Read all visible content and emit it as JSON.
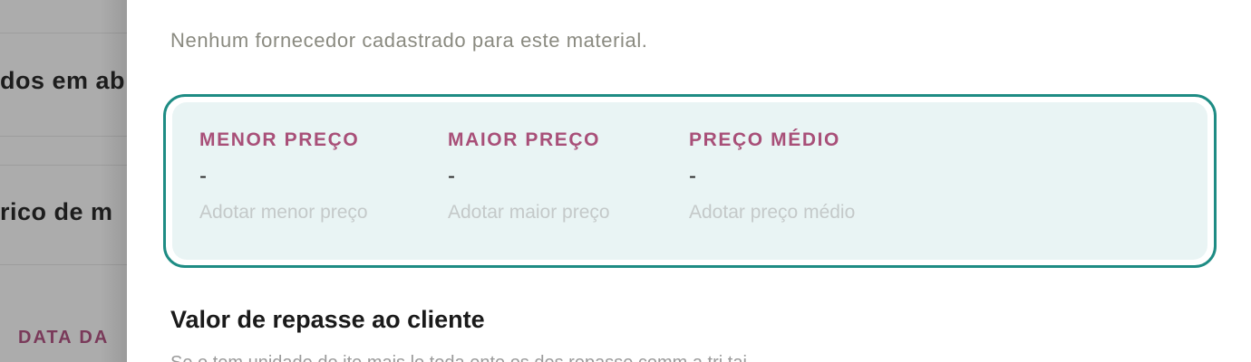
{
  "background": {
    "heading_1": "dos em ab",
    "heading_2": "rico de m",
    "column_label": "DATA DA"
  },
  "drawer": {
    "empty_message": "Nenhum fornecedor cadastrado para este material.",
    "price_summary": {
      "min": {
        "label": "MENOR PREÇO",
        "value": "-",
        "action": "Adotar menor preço"
      },
      "max": {
        "label": "MAIOR PREÇO",
        "value": "-",
        "action": "Adotar maior preço"
      },
      "avg": {
        "label": "PREÇO MÉDIO",
        "value": "-",
        "action": "Adotar preço médio"
      }
    },
    "repasse": {
      "title": "Valor de repasse ao cliente",
      "subtitle": "Se o tem unidade do ite mais lo toda ente os des repasse comm a tri tai"
    }
  },
  "colors": {
    "accent_border": "#1e8c84",
    "card_bg": "#e9f4f4",
    "label_color": "#a84f78"
  }
}
